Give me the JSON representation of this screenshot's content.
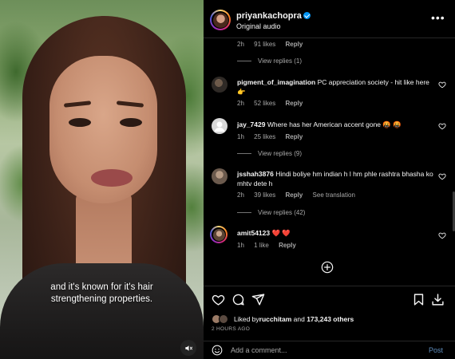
{
  "video": {
    "caption_line1": "and it's known for  it's hair",
    "caption_line2": "strengthening properties."
  },
  "post": {
    "username": "priyankachopra",
    "subtitle": "Original audio"
  },
  "comments": [
    {
      "id": "top",
      "time": "2h",
      "likes": "91 likes",
      "reply": "Reply",
      "view_replies": "View replies (1)"
    },
    {
      "username": "pigment_of_imagination",
      "text": " PC appreciation society - hit like here 👉",
      "time": "2h",
      "likes": "52 likes",
      "reply": "Reply"
    },
    {
      "username": "jay_7429",
      "text": " Where has her American accent gone 🤬 🤬",
      "time": "1h",
      "likes": "25 likes",
      "reply": "Reply",
      "view_replies": "View replies (9)"
    },
    {
      "username": "jsshah3876",
      "text": " Hindi boliye hm indian h l hm phle rashtra bhasha ko mhtv dete h",
      "time": "2h",
      "likes": "39 likes",
      "reply": "Reply",
      "see_translation": "See translation",
      "view_replies": "View replies (42)"
    },
    {
      "username": "amit54123",
      "text": " ❤️ ❤️",
      "time": "1h",
      "likes": "1 like",
      "reply": "Reply"
    }
  ],
  "footer": {
    "liked_by_prefix": "Liked by ",
    "liked_by_user": "rucchitam",
    "liked_by_and": " and ",
    "liked_by_count": "173,243 others",
    "time_ago": "2 HOURS AGO",
    "add_comment_placeholder": "Add a comment...",
    "post_label": "Post"
  },
  "colors": {
    "background": "#000000",
    "text": "#f5f5f5",
    "muted": "#a8a8a8",
    "link_blue": "#5f8dbd",
    "verified_blue": "#0095f6"
  },
  "icons": [
    "more-options-icon",
    "heart-icon",
    "comment-icon",
    "share-icon",
    "bookmark-icon",
    "download-icon",
    "add-comments-icon",
    "emoji-icon",
    "mute-icon",
    "verified-badge-icon"
  ]
}
